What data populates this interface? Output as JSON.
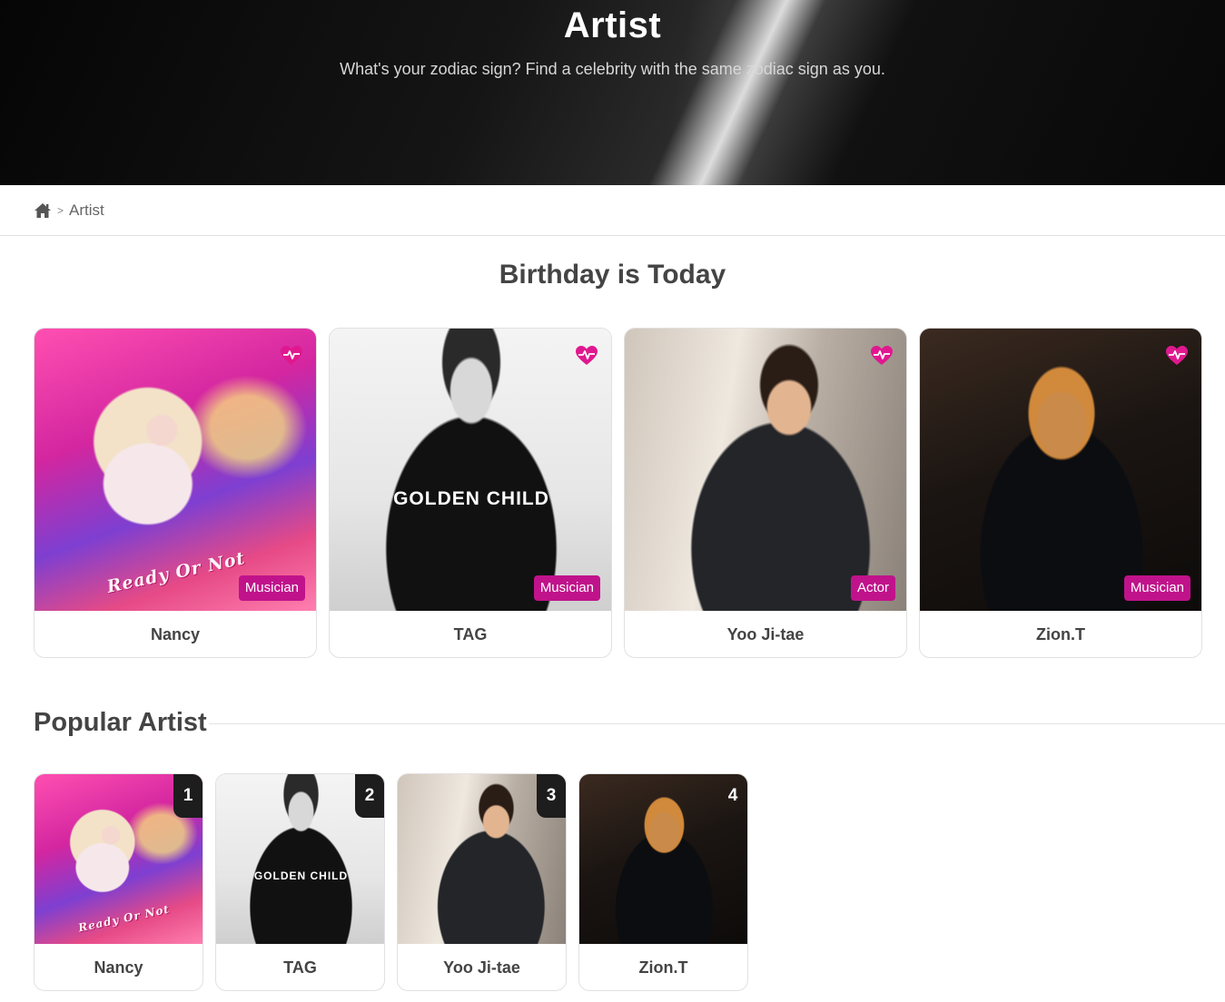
{
  "hero": {
    "title": "Artist",
    "subtitle": "What's your zodiac sign? Find a celebrity with the same zodiac sign as you."
  },
  "breadcrumb": {
    "home_icon": "home-icon",
    "separator": ">",
    "current": "Artist"
  },
  "birthday": {
    "title": "Birthday is Today",
    "cards": [
      {
        "name": "Nancy",
        "tag": "Musician",
        "photo_text": "Ready Or Not"
      },
      {
        "name": "TAG",
        "tag": "Musician",
        "photo_text": "GOLDEN CHILD"
      },
      {
        "name": "Yoo Ji-tae",
        "tag": "Actor",
        "photo_text": ""
      },
      {
        "name": "Zion.T",
        "tag": "Musician",
        "photo_text": ""
      }
    ]
  },
  "popular": {
    "title": "Popular Artist",
    "cards": [
      {
        "rank": "1",
        "name": "Nancy",
        "photo_text": "Ready Or Not"
      },
      {
        "rank": "2",
        "name": "TAG",
        "photo_text": "GOLDEN CHILD"
      },
      {
        "rank": "3",
        "name": "Yoo Ji-tae",
        "photo_text": ""
      },
      {
        "rank": "4",
        "name": "Zion.T",
        "photo_text": ""
      }
    ]
  },
  "colors": {
    "accent": "#c0138b",
    "underline": "#f6c4ea",
    "rank_bg": "#1d1d1d"
  }
}
